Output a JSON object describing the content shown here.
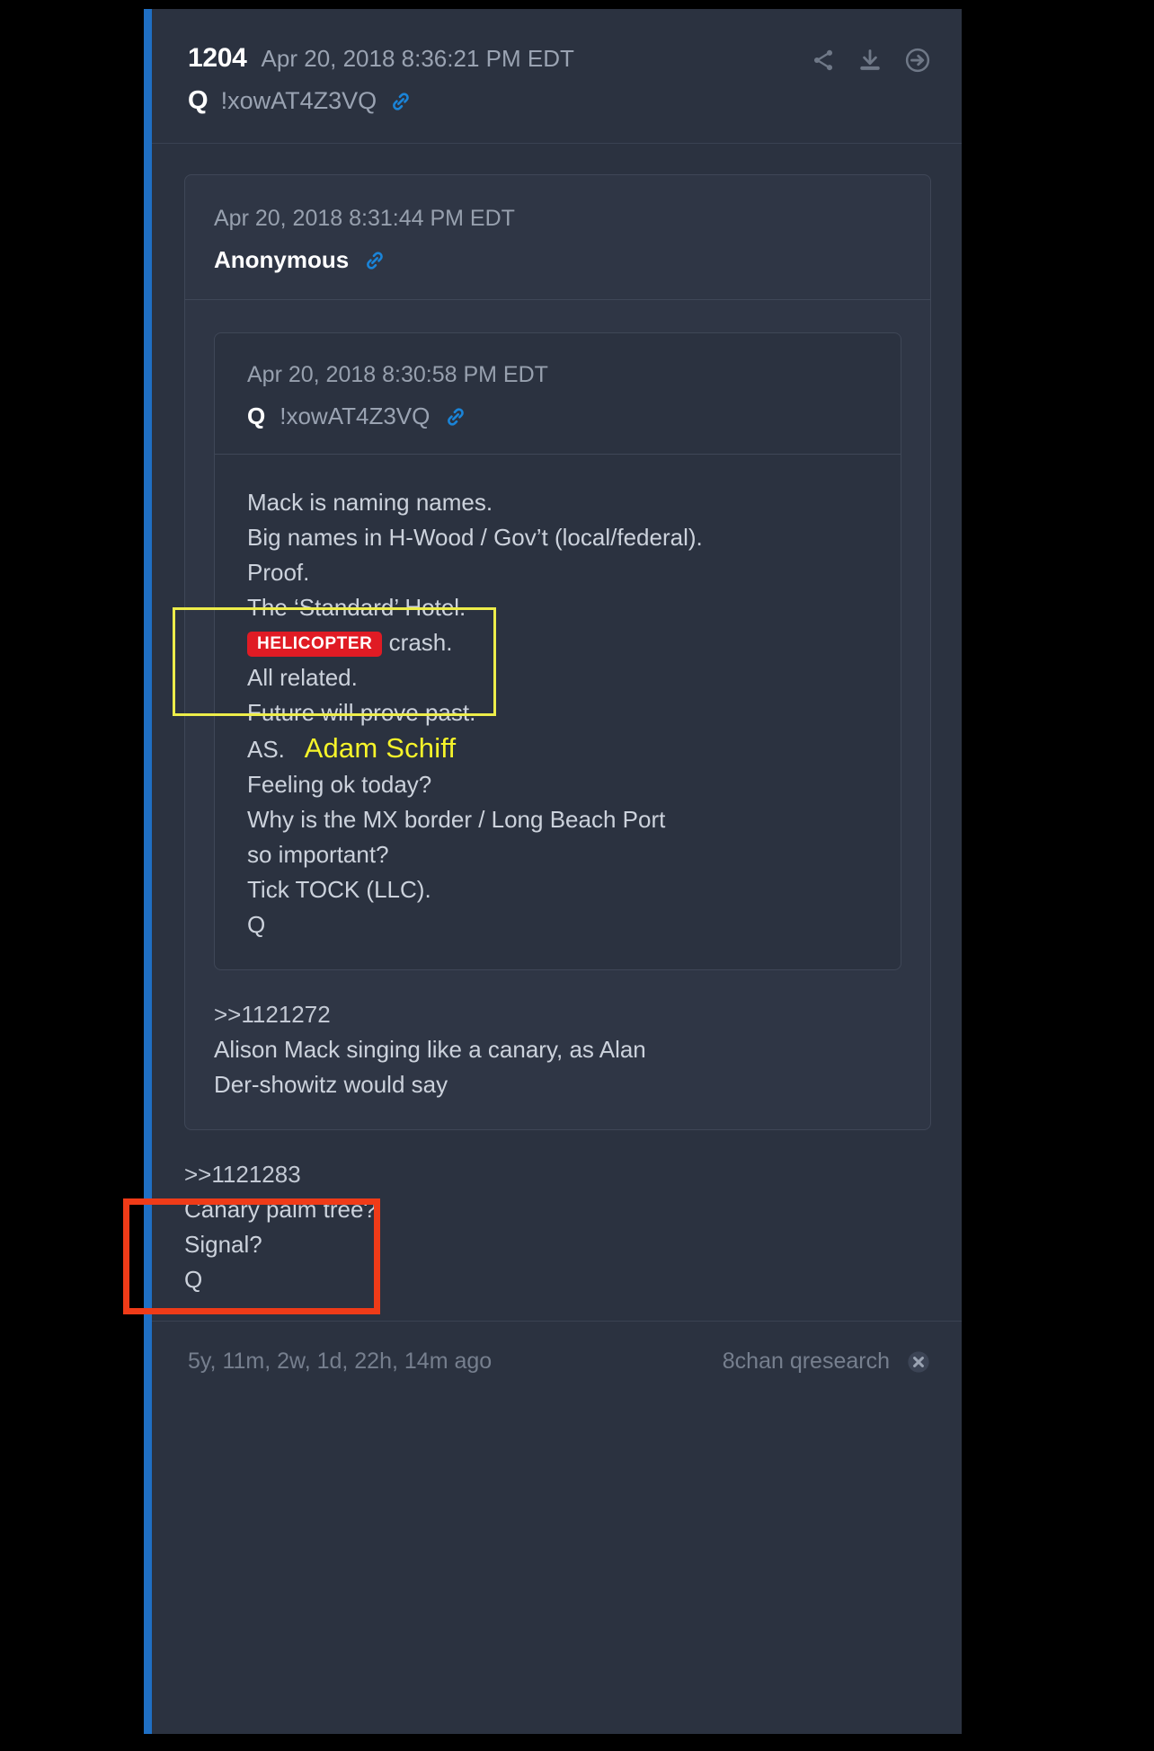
{
  "post": {
    "number": "1204",
    "date": "Apr 20, 2018 8:36:21 PM EDT",
    "author_sigil": "Q",
    "tripcode": "!xowAT4Z3VQ",
    "actions": [
      {
        "icon": "share-icon",
        "label": "Share"
      },
      {
        "icon": "download-icon",
        "label": "Download"
      },
      {
        "icon": "arrow-right-circle-icon",
        "label": "Go to post"
      }
    ],
    "link_icon": "link-icon"
  },
  "quote_level1": {
    "date": "Apr 20, 2018 8:31:44 PM EDT",
    "author": "Anonymous",
    "link_icon": "link-icon",
    "reply_ref": ">>1121272",
    "reply_body": "Alison Mack singing like a canary, as Alan Der-showitz would say"
  },
  "quote_level2": {
    "date": "Apr 20, 2018 8:30:58 PM EDT",
    "author_sigil": "Q",
    "tripcode": "!xowAT4Z3VQ",
    "link_icon": "link-icon",
    "lines": {
      "l1": "Mack is naming names.",
      "l2": "Big names in H-Wood / Gov’t (local/federal).",
      "l3": "Proof.",
      "l4": "The ‘Standard’ Hotel.",
      "l5_badge": "HELICOPTER",
      "l5_rest": " crash.",
      "l6": "All related.",
      "l7": "Future will prove past.",
      "l8_label": "AS.",
      "l8_annotation": "Adam Schiff",
      "l9": "Feeling ok today?",
      "l10": "Why is the MX border / Long Beach Port so important?",
      "l11": "Tick TOCK (LLC).",
      "l12": "Q"
    }
  },
  "outer_reply": {
    "reply_ref": ">>1121283",
    "l1": "Canary palm tree?",
    "l2": "Signal?",
    "l3": "Q"
  },
  "footer": {
    "ago": "5y, 11m, 2w, 1d, 22h, 14m ago",
    "source": "8chan qresearch",
    "close_icon": "close-circle-icon"
  },
  "colors": {
    "accent_bar": "#1f6fc4",
    "link_blue": "#1a84d8",
    "badge_red": "#e01b24",
    "annotation_yellow": "#eded4a",
    "annotation_red": "#ef3b18",
    "card_bg": "#2b3240",
    "quote_bg": "#2f3645",
    "page_bg": "#000000"
  }
}
